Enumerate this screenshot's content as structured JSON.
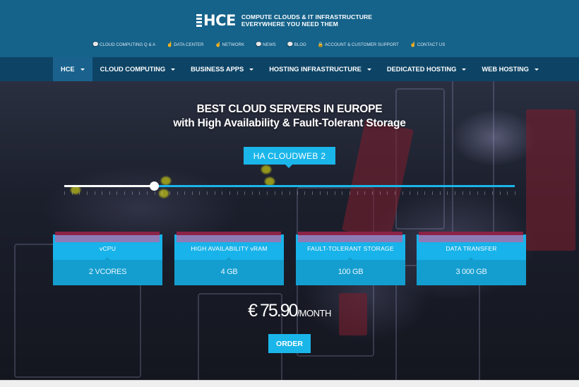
{
  "brand": {
    "logo_text": "HCE",
    "tagline_line1": "COMPUTE CLOUDS & IT INFRASTRUCTURE",
    "tagline_line2": "EVERYWHERE YOU NEED THEM"
  },
  "utility_nav": [
    {
      "label": "CLOUD COMPUTING Q & A",
      "icon": "speech-bubble-icon",
      "glyph": "💬"
    },
    {
      "label": "DATA CENTER",
      "icon": "hand-pointer-icon",
      "glyph": "☝"
    },
    {
      "label": "NETWORK",
      "icon": "hand-pointer-icon",
      "glyph": "☝"
    },
    {
      "label": "NEWS",
      "icon": "speech-bubble-icon",
      "glyph": "💬"
    },
    {
      "label": "BLOG",
      "icon": "speech-bubble-icon",
      "glyph": "💬"
    },
    {
      "label": "ACCOUNT & CUSTOMER SUPPORT",
      "icon": "lock-icon",
      "glyph": "🔒"
    },
    {
      "label": "CONTACT US",
      "icon": "hand-pointer-icon",
      "glyph": "☝"
    }
  ],
  "main_nav": [
    {
      "label": "HCE",
      "active": true
    },
    {
      "label": "CLOUD COMPUTING",
      "active": false
    },
    {
      "label": "BUSINESS APPS",
      "active": false
    },
    {
      "label": "HOSTING INFRASTRUCTURE",
      "active": false
    },
    {
      "label": "DEDICATED HOSTING",
      "active": false
    },
    {
      "label": "WEB HOSTING",
      "active": false
    }
  ],
  "hero": {
    "title_line1": "BEST CLOUD SERVERS IN EUROPE",
    "title_line2": "with High Availability & Fault-Tolerant Storage",
    "plan_name": "HA CLOUDWEB 2",
    "slider": {
      "position_fraction": 0.2,
      "tick_count": 60
    },
    "specs": [
      {
        "label": "vCPU",
        "value": "2 VCORES"
      },
      {
        "label": "HIGH AVAILABILITY vRAM",
        "value": "4 GB"
      },
      {
        "label": "FAULT-TOLERANT STORAGE",
        "value": "100 GB"
      },
      {
        "label": "DATA TRANSFER",
        "value": "3 000 GB"
      }
    ],
    "price": "€ 75.90",
    "price_period": "/MONTH",
    "order_label": "ORDER"
  },
  "colors": {
    "header_bg": "#15628a",
    "nav_bg": "#0d4466",
    "nav_active_bg": "#1a628d",
    "accent": "#1ab6ea",
    "card_value_bg": "#149ecf"
  }
}
